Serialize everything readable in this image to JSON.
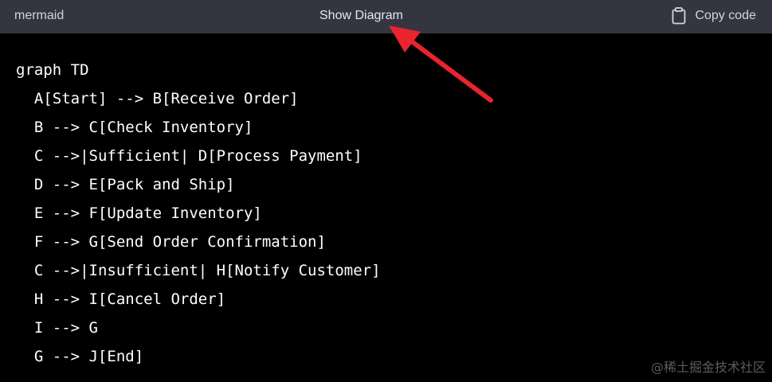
{
  "header": {
    "language": "mermaid",
    "show_diagram_label": "Show Diagram",
    "copy_label": "Copy code",
    "copy_icon": "clipboard-icon"
  },
  "code": {
    "lines": [
      "graph TD",
      "  A[Start] --> B[Receive Order]",
      "  B --> C[Check Inventory]",
      "  C -->|Sufficient| D[Process Payment]",
      "  D --> E[Pack and Ship]",
      "  E --> F[Update Inventory]",
      "  F --> G[Send Order Confirmation]",
      "  C -->|Insufficient| H[Notify Customer]",
      "  H --> I[Cancel Order]",
      "  I --> G",
      "  G --> J[End]"
    ]
  },
  "annotation": {
    "arrow_color": "#e8242f"
  },
  "watermark": "@稀土掘金技术社区",
  "colors": {
    "header_bg": "#343541",
    "code_bg": "#000000",
    "code_text": "#ffffff"
  }
}
